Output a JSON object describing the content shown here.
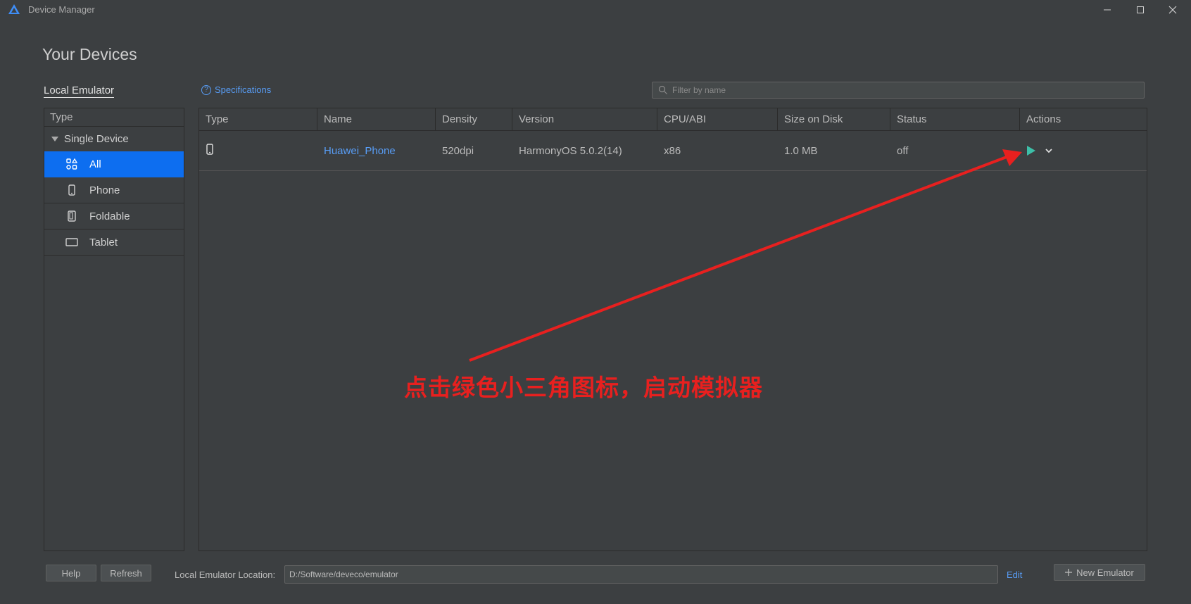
{
  "window": {
    "title": "Device Manager"
  },
  "page": {
    "title": "Your Devices"
  },
  "tabs": {
    "local": "Local Emulator"
  },
  "specifications": {
    "label": "Specifications",
    "icon": "question-circle-icon"
  },
  "filter": {
    "placeholder": "Filter by name",
    "value": ""
  },
  "sidebar": {
    "header": "Type",
    "group": "Single Device",
    "items": [
      {
        "label": "All",
        "icon": "all-grid-icon",
        "active": true
      },
      {
        "label": "Phone",
        "icon": "phone-icon",
        "active": false
      },
      {
        "label": "Foldable",
        "icon": "foldable-icon",
        "active": false
      },
      {
        "label": "Tablet",
        "icon": "tablet-icon",
        "active": false
      }
    ]
  },
  "table": {
    "columns": [
      "Type",
      "Name",
      "Density",
      "Version",
      "CPU/ABI",
      "Size on Disk",
      "Status",
      "Actions"
    ],
    "rows": [
      {
        "type_icon": "phone-icon",
        "name": "Huawei_Phone",
        "density": "520dpi",
        "version": "HarmonyOS 5.0.2(14)",
        "cpu": "x86",
        "size": "1.0 MB",
        "status": "off"
      }
    ]
  },
  "annotation": {
    "text": "点击绿色小三角图标，启动模拟器",
    "color": "#e8201f"
  },
  "footer": {
    "help": "Help",
    "refresh": "Refresh",
    "location_label": "Local Emulator Location:",
    "location_value": "D:/Software/deveco/emulator",
    "edit": "Edit",
    "new_emulator": "New Emulator"
  },
  "colors": {
    "accent": "#0d6ef0",
    "link": "#589df6",
    "play": "#3dbfa8",
    "background": "#3c3f41"
  }
}
